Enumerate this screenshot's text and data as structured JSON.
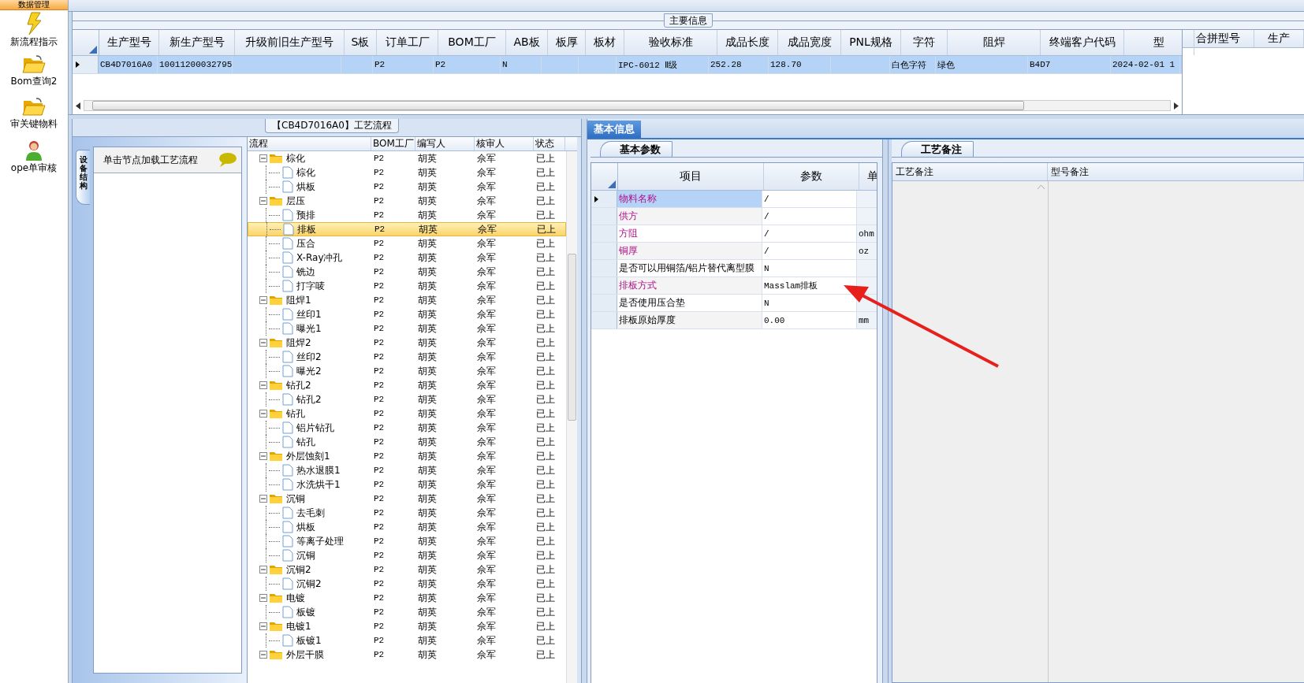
{
  "sidebar": {
    "header": "数据管理",
    "items": [
      {
        "label": "新流程指示"
      },
      {
        "label": "Bom查询2"
      },
      {
        "label": "审关键物料"
      },
      {
        "label": "ope单审核"
      }
    ]
  },
  "main_info": {
    "title": "主要信息",
    "columns": [
      "生产型号",
      "新生产型号",
      "升级前旧生产型号",
      "S板",
      "订单工厂",
      "BOM工厂",
      "AB板",
      "板厚",
      "板材",
      "验收标准",
      "成品长度",
      "成品宽度",
      "PNL规格",
      "字符",
      "阻焊",
      "终端客户代码",
      "型"
    ],
    "rows": [
      {
        "selected": true,
        "cells": [
          "CB4D7016A0",
          "10011200032795",
          null,
          null,
          "P2",
          "P2",
          "N",
          null,
          null,
          "IPC-6012 Ⅱ级",
          "252.28",
          "128.70",
          null,
          "白色字符",
          "绿色",
          "B4D7",
          "2024-02-01 1"
        ]
      }
    ]
  },
  "merge_panel": {
    "columns": [
      "合拼型号",
      "生产"
    ]
  },
  "structure_pane": {
    "tab": "设备结构",
    "hint": "单击节点加载工艺流程"
  },
  "process_flow": {
    "title": "【CB4D7016A0】工艺流程",
    "columns": [
      "流程",
      "BOM工厂",
      "编写人",
      "核审人",
      "状态"
    ],
    "tree": [
      {
        "label": "棕化",
        "kind": "group",
        "expanded": true,
        "selected": false,
        "bom_factory": "P2",
        "writer": "胡英",
        "reviewer": "佘军",
        "status": "已上",
        "children": [
          {
            "label": "棕化",
            "kind": "step",
            "selected": false,
            "bom_factory": "P2",
            "writer": "胡英",
            "reviewer": "佘军",
            "status": "已上"
          },
          {
            "label": "烘板",
            "kind": "step",
            "selected": false,
            "bom_factory": "P2",
            "writer": "胡英",
            "reviewer": "佘军",
            "status": "已上"
          }
        ]
      },
      {
        "label": "层压",
        "kind": "group",
        "expanded": true,
        "selected": false,
        "bom_factory": "P2",
        "writer": "胡英",
        "reviewer": "佘军",
        "status": "已上",
        "children": [
          {
            "label": "预排",
            "kind": "step",
            "selected": false,
            "bom_factory": "P2",
            "writer": "胡英",
            "reviewer": "佘军",
            "status": "已上"
          },
          {
            "label": "排板",
            "kind": "step",
            "selected": true,
            "bom_factory": "P2",
            "writer": "胡英",
            "reviewer": "佘军",
            "status": "已上"
          },
          {
            "label": "压合",
            "kind": "step",
            "selected": false,
            "bom_factory": "P2",
            "writer": "胡英",
            "reviewer": "佘军",
            "status": "已上"
          },
          {
            "label": "X-Ray冲孔",
            "kind": "step",
            "selected": false,
            "bom_factory": "P2",
            "writer": "胡英",
            "reviewer": "佘军",
            "status": "已上"
          },
          {
            "label": "铣边",
            "kind": "step",
            "selected": false,
            "bom_factory": "P2",
            "writer": "胡英",
            "reviewer": "佘军",
            "status": "已上"
          },
          {
            "label": "打字唛",
            "kind": "step",
            "selected": false,
            "bom_factory": "P2",
            "writer": "胡英",
            "reviewer": "佘军",
            "status": "已上"
          }
        ]
      },
      {
        "label": "阻焊1",
        "kind": "group",
        "expanded": true,
        "selected": false,
        "bom_factory": "P2",
        "writer": "胡英",
        "reviewer": "佘军",
        "status": "已上",
        "children": [
          {
            "label": "丝印1",
            "kind": "step",
            "selected": false,
            "bom_factory": "P2",
            "writer": "胡英",
            "reviewer": "佘军",
            "status": "已上"
          },
          {
            "label": "曝光1",
            "kind": "step",
            "selected": false,
            "bom_factory": "P2",
            "writer": "胡英",
            "reviewer": "佘军",
            "status": "已上"
          }
        ]
      },
      {
        "label": "阻焊2",
        "kind": "group",
        "expanded": true,
        "selected": false,
        "bom_factory": "P2",
        "writer": "胡英",
        "reviewer": "佘军",
        "status": "已上",
        "children": [
          {
            "label": "丝印2",
            "kind": "step",
            "selected": false,
            "bom_factory": "P2",
            "writer": "胡英",
            "reviewer": "佘军",
            "status": "已上"
          },
          {
            "label": "曝光2",
            "kind": "step",
            "selected": false,
            "bom_factory": "P2",
            "writer": "胡英",
            "reviewer": "佘军",
            "status": "已上"
          }
        ]
      },
      {
        "label": "钻孔2",
        "kind": "group",
        "expanded": true,
        "selected": false,
        "bom_factory": "P2",
        "writer": "胡英",
        "reviewer": "佘军",
        "status": "已上",
        "children": [
          {
            "label": "钻孔2",
            "kind": "step",
            "selected": false,
            "bom_factory": "P2",
            "writer": "胡英",
            "reviewer": "佘军",
            "status": "已上"
          }
        ]
      },
      {
        "label": "钻孔",
        "kind": "group",
        "expanded": true,
        "selected": false,
        "bom_factory": "P2",
        "writer": "胡英",
        "reviewer": "佘军",
        "status": "已上",
        "children": [
          {
            "label": "铝片钻孔",
            "kind": "step",
            "selected": false,
            "bom_factory": "P2",
            "writer": "胡英",
            "reviewer": "佘军",
            "status": "已上"
          },
          {
            "label": "钻孔",
            "kind": "step",
            "selected": false,
            "bom_factory": "P2",
            "writer": "胡英",
            "reviewer": "佘军",
            "status": "已上"
          }
        ]
      },
      {
        "label": "外层蚀刻1",
        "kind": "group",
        "expanded": true,
        "selected": false,
        "bom_factory": "P2",
        "writer": "胡英",
        "reviewer": "佘军",
        "status": "已上",
        "children": [
          {
            "label": "热水退膜1",
            "kind": "step",
            "selected": false,
            "bom_factory": "P2",
            "writer": "胡英",
            "reviewer": "佘军",
            "status": "已上"
          },
          {
            "label": "水洗烘干1",
            "kind": "step",
            "selected": false,
            "bom_factory": "P2",
            "writer": "胡英",
            "reviewer": "佘军",
            "status": "已上"
          }
        ]
      },
      {
        "label": "沉铜",
        "kind": "group",
        "expanded": true,
        "selected": false,
        "bom_factory": "P2",
        "writer": "胡英",
        "reviewer": "佘军",
        "status": "已上",
        "children": [
          {
            "label": "去毛刺",
            "kind": "step",
            "selected": false,
            "bom_factory": "P2",
            "writer": "胡英",
            "reviewer": "佘军",
            "status": "已上"
          },
          {
            "label": "烘板",
            "kind": "step",
            "selected": false,
            "bom_factory": "P2",
            "writer": "胡英",
            "reviewer": "佘军",
            "status": "已上"
          },
          {
            "label": "等离子处理",
            "kind": "step",
            "selected": false,
            "bom_factory": "P2",
            "writer": "胡英",
            "reviewer": "佘军",
            "status": "已上"
          },
          {
            "label": "沉铜",
            "kind": "step",
            "selected": false,
            "bom_factory": "P2",
            "writer": "胡英",
            "reviewer": "佘军",
            "status": "已上"
          }
        ]
      },
      {
        "label": "沉铜2",
        "kind": "group",
        "expanded": true,
        "selected": false,
        "bom_factory": "P2",
        "writer": "胡英",
        "reviewer": "佘军",
        "status": "已上",
        "children": [
          {
            "label": "沉铜2",
            "kind": "step",
            "selected": false,
            "bom_factory": "P2",
            "writer": "胡英",
            "reviewer": "佘军",
            "status": "已上"
          }
        ]
      },
      {
        "label": "电镀",
        "kind": "group",
        "expanded": true,
        "selected": false,
        "bom_factory": "P2",
        "writer": "胡英",
        "reviewer": "佘军",
        "status": "已上",
        "children": [
          {
            "label": "板镀",
            "kind": "step",
            "selected": false,
            "bom_factory": "P2",
            "writer": "胡英",
            "reviewer": "佘军",
            "status": "已上"
          }
        ]
      },
      {
        "label": "电镀1",
        "kind": "group",
        "expanded": true,
        "selected": false,
        "bom_factory": "P2",
        "writer": "胡英",
        "reviewer": "佘军",
        "status": "已上",
        "children": [
          {
            "label": "板镀1",
            "kind": "step",
            "selected": false,
            "bom_factory": "P2",
            "writer": "胡英",
            "reviewer": "佘军",
            "status": "已上"
          }
        ]
      },
      {
        "label": "外层干膜",
        "kind": "group",
        "expanded": true,
        "selected": false,
        "bom_factory": "P2",
        "writer": "胡英",
        "reviewer": "佘军",
        "status": "已上"
      }
    ]
  },
  "detail_tabs": [
    {
      "label": "基本信息",
      "selected": true
    }
  ],
  "basic_params": {
    "tab": "基本参数",
    "columns": [
      "项目",
      "参数",
      "单"
    ],
    "rows": [
      {
        "item": "物料名称",
        "value": "/",
        "required": true,
        "selected": true
      },
      {
        "item": "供方",
        "value": "/",
        "required": true,
        "selected": false
      },
      {
        "item": "方阻",
        "value": "/",
        "unit": "ohm",
        "required": true,
        "selected": false
      },
      {
        "item": "铜厚",
        "value": "/",
        "unit": "oz",
        "required": true,
        "selected": false
      },
      {
        "item": "是否可以用铜箔/铝片替代离型膜",
        "value": "N",
        "required": false,
        "selected": false
      },
      {
        "item": "排板方式",
        "value": "Masslam排板",
        "required": true,
        "selected": false
      },
      {
        "item": "是否使用压合垫",
        "value": "N",
        "required": false,
        "selected": false
      },
      {
        "item": "排板原始厚度",
        "value": "0.00",
        "unit": "mm",
        "required": false,
        "selected": false
      }
    ]
  },
  "process_notes": {
    "tab": "工艺备注",
    "columns": [
      "工艺备注",
      "型号备注"
    ]
  },
  "annotation": {
    "kind": "arrow"
  }
}
